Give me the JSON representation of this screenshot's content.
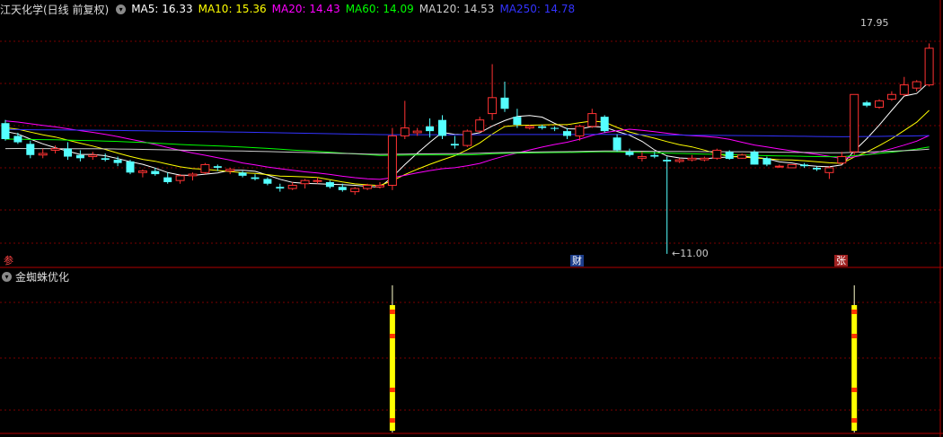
{
  "main_panel": {
    "title": "江天化学(日线 前复权)",
    "indicators": [
      {
        "label": "MA5: 16.33",
        "color": "#ffffff"
      },
      {
        "label": "MA10: 15.36",
        "color": "#ffff00"
      },
      {
        "label": "MA20: 14.43",
        "color": "#ff00ff"
      },
      {
        "label": "MA60: 14.09",
        "color": "#00ff00"
      },
      {
        "label": "MA120: 14.53",
        "color": "#cccccc"
      },
      {
        "label": "MA250: 14.78",
        "color": "#3333ff"
      }
    ],
    "high_price_label": "17.95",
    "low_price_label": "11.00",
    "event_tags": {
      "left": "参",
      "middle": "财",
      "right": "张"
    }
  },
  "sub_panel": {
    "title": "金蜘蛛优化"
  },
  "colors": {
    "up": "#ff3333",
    "down": "#54ffff",
    "grid": "#7a0000",
    "signal": "#ffff00"
  },
  "chart_data": {
    "type": "candlestick",
    "ohlc": [
      [
        15.1,
        15.2,
        14.55,
        14.6
      ],
      [
        14.7,
        14.8,
        14.45,
        14.5
      ],
      [
        14.45,
        14.55,
        14.0,
        14.1
      ],
      [
        14.1,
        14.3,
        14.0,
        14.15
      ],
      [
        14.25,
        14.4,
        14.15,
        14.3
      ],
      [
        14.3,
        14.5,
        13.95,
        14.05
      ],
      [
        14.1,
        14.25,
        13.9,
        14.0
      ],
      [
        14.05,
        14.2,
        13.95,
        14.1
      ],
      [
        14.0,
        14.15,
        13.9,
        13.95
      ],
      [
        13.95,
        14.05,
        13.75,
        13.85
      ],
      [
        13.9,
        13.95,
        13.5,
        13.55
      ],
      [
        13.55,
        13.65,
        13.4,
        13.6
      ],
      [
        13.6,
        13.7,
        13.45,
        13.5
      ],
      [
        13.4,
        13.55,
        13.2,
        13.25
      ],
      [
        13.3,
        13.5,
        13.2,
        13.45
      ],
      [
        13.45,
        13.55,
        13.3,
        13.5
      ],
      [
        13.55,
        13.85,
        13.5,
        13.8
      ],
      [
        13.75,
        13.8,
        13.6,
        13.7
      ],
      [
        13.6,
        13.7,
        13.5,
        13.65
      ],
      [
        13.55,
        13.6,
        13.4,
        13.45
      ],
      [
        13.4,
        13.5,
        13.3,
        13.35
      ],
      [
        13.35,
        13.4,
        13.15,
        13.2
      ],
      [
        13.1,
        13.2,
        12.95,
        13.05
      ],
      [
        13.05,
        13.25,
        13.0,
        13.15
      ],
      [
        13.2,
        13.35,
        13.05,
        13.3
      ],
      [
        13.3,
        13.4,
        13.2,
        13.3
      ],
      [
        13.25,
        13.3,
        13.05,
        13.1
      ],
      [
        13.1,
        13.2,
        12.95,
        13.0
      ],
      [
        12.95,
        13.1,
        12.85,
        13.05
      ],
      [
        13.05,
        13.2,
        13.0,
        13.15
      ],
      [
        13.1,
        13.25,
        13.05,
        13.15
      ],
      [
        13.15,
        14.95,
        13.0,
        14.7
      ],
      [
        14.7,
        15.8,
        14.6,
        14.95
      ],
      [
        14.8,
        14.95,
        14.7,
        14.85
      ],
      [
        15.0,
        15.25,
        14.65,
        14.85
      ],
      [
        15.2,
        15.35,
        14.6,
        14.7
      ],
      [
        14.45,
        14.7,
        14.3,
        14.4
      ],
      [
        14.4,
        14.9,
        14.35,
        14.85
      ],
      [
        14.85,
        15.3,
        14.8,
        15.2
      ],
      [
        15.4,
        16.95,
        15.2,
        15.9
      ],
      [
        15.9,
        16.4,
        15.45,
        15.55
      ],
      [
        15.3,
        15.55,
        14.95,
        15.05
      ],
      [
        14.95,
        15.05,
        14.9,
        15.0
      ],
      [
        15.0,
        15.05,
        14.9,
        14.95
      ],
      [
        14.95,
        15.0,
        14.85,
        14.92
      ],
      [
        14.85,
        14.95,
        14.6,
        14.7
      ],
      [
        14.7,
        15.05,
        14.55,
        15.0
      ],
      [
        15.0,
        15.55,
        14.95,
        15.4
      ],
      [
        15.3,
        15.35,
        14.8,
        14.85
      ],
      [
        14.65,
        14.75,
        14.2,
        14.25
      ],
      [
        14.2,
        14.3,
        14.05,
        14.1
      ],
      [
        14.0,
        14.2,
        13.9,
        14.05
      ],
      [
        14.1,
        14.2,
        14.0,
        14.05
      ],
      [
        13.95,
        14.05,
        11.0,
        13.9
      ],
      [
        13.9,
        14.0,
        13.85,
        13.95
      ],
      [
        13.95,
        14.1,
        13.9,
        14.0
      ],
      [
        13.95,
        14.05,
        13.9,
        14.0
      ],
      [
        14.0,
        14.3,
        13.95,
        14.25
      ],
      [
        14.2,
        14.25,
        13.95,
        13.98
      ],
      [
        14.0,
        14.15,
        13.98,
        14.1
      ],
      [
        14.2,
        14.25,
        13.8,
        13.8
      ],
      [
        14.0,
        14.05,
        13.75,
        13.8
      ],
      [
        13.75,
        13.8,
        13.7,
        13.75
      ],
      [
        13.7,
        13.8,
        13.7,
        13.8
      ],
      [
        13.8,
        13.85,
        13.7,
        13.75
      ],
      [
        13.7,
        13.75,
        13.6,
        13.65
      ],
      [
        13.55,
        13.75,
        13.35,
        13.7
      ],
      [
        13.85,
        14.2,
        13.8,
        14.05
      ],
      [
        14.2,
        16.0,
        14.1,
        16.0
      ],
      [
        15.75,
        15.8,
        15.6,
        15.65
      ],
      [
        15.6,
        15.85,
        15.55,
        15.8
      ],
      [
        15.85,
        16.1,
        15.8,
        16.0
      ],
      [
        16.0,
        16.55,
        15.95,
        16.3
      ],
      [
        16.2,
        16.45,
        16.1,
        16.4
      ],
      [
        16.3,
        17.6,
        16.25,
        17.45
      ]
    ],
    "ma_lines": [
      "MA5",
      "MA10",
      "MA20",
      "MA60",
      "MA120",
      "MA250"
    ],
    "high_annotation": 17.95,
    "low_annotation": 11.0,
    "signals": [
      31,
      68
    ]
  }
}
